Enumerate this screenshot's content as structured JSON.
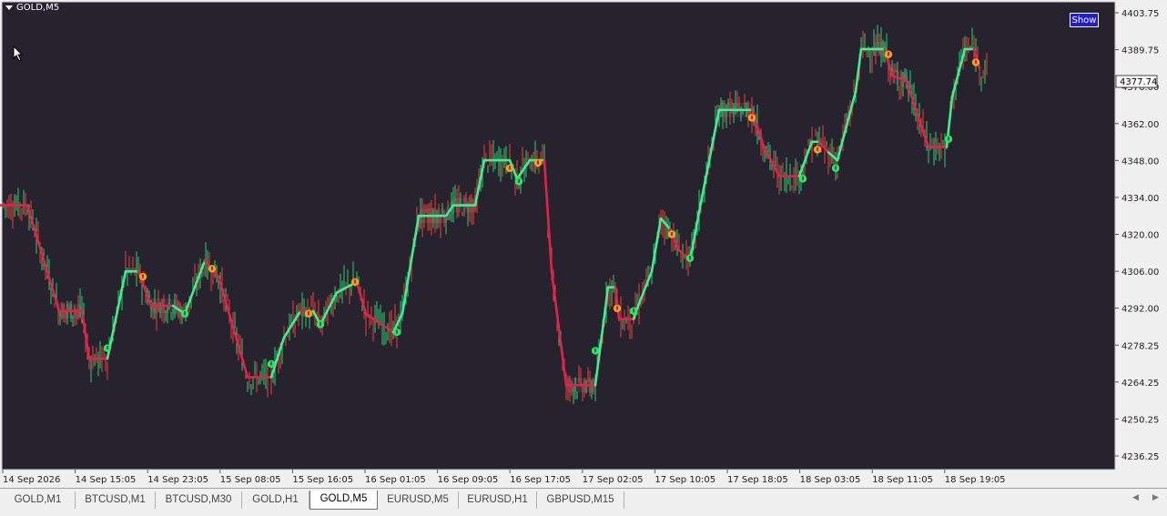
{
  "window": {
    "symbol_title": "GOLD,M5",
    "show_button": "Show",
    "current_price": "4377.74"
  },
  "colors": {
    "background": "#27232e",
    "grid_border": "#c8c8c8",
    "bull_candle": "#2ecc71",
    "bear_candle": "#e8413c",
    "trend_up": "#3df08f",
    "trend_down": "#e0234a",
    "signal_sell": "#f3a11d",
    "signal_buy": "#2ee36a",
    "axis_text": "#222222"
  },
  "price_axis": {
    "labels": [
      "4403.75",
      "4389.75",
      "4376.00",
      "4362.00",
      "4348.00",
      "4334.00",
      "4320.00",
      "4306.00",
      "4292.00",
      "4278.25",
      "4264.25",
      "4250.25",
      "4236.25"
    ]
  },
  "time_axis": {
    "labels": [
      "14 Sep 2026",
      "14 Sep 15:05",
      "14 Sep 23:05",
      "15 Sep 08:05",
      "15 Sep 16:05",
      "16 Sep 01:05",
      "16 Sep 09:05",
      "16 Sep 17:05",
      "17 Sep 02:05",
      "17 Sep 10:05",
      "17 Sep 18:05",
      "18 Sep 03:05",
      "18 Sep 11:05",
      "18 Sep 19:05"
    ]
  },
  "trend_line": {
    "points": [
      [
        0,
        4331,
        "d"
      ],
      [
        30,
        4331,
        "d"
      ],
      [
        65,
        4291,
        "d"
      ],
      [
        90,
        4291,
        "d"
      ],
      [
        98,
        4273,
        "d"
      ],
      [
        118,
        4273,
        "d"
      ],
      [
        138,
        4306,
        "u"
      ],
      [
        152,
        4306,
        "u"
      ],
      [
        166,
        4293,
        "d"
      ],
      [
        190,
        4293,
        "d"
      ],
      [
        203,
        4290,
        "u"
      ],
      [
        225,
        4310,
        "u"
      ],
      [
        240,
        4304,
        "d"
      ],
      [
        272,
        4266,
        "d"
      ],
      [
        298,
        4266,
        "d"
      ],
      [
        312,
        4281,
        "u"
      ],
      [
        330,
        4291,
        "u"
      ],
      [
        344,
        4291,
        "d"
      ],
      [
        352,
        4286,
        "u"
      ],
      [
        370,
        4298,
        "u"
      ],
      [
        392,
        4302,
        "u"
      ],
      [
        402,
        4290,
        "d"
      ],
      [
        432,
        4283,
        "d"
      ],
      [
        442,
        4290,
        "u"
      ],
      [
        460,
        4327,
        "u"
      ],
      [
        490,
        4327,
        "u"
      ],
      [
        498,
        4331,
        "u"
      ],
      [
        522,
        4331,
        "u"
      ],
      [
        532,
        4348,
        "u"
      ],
      [
        560,
        4348,
        "u"
      ],
      [
        568,
        4341,
        "u"
      ],
      [
        582,
        4348,
        "u"
      ],
      [
        598,
        4348,
        "u"
      ],
      [
        606,
        4306,
        "d"
      ],
      [
        622,
        4263,
        "d"
      ],
      [
        654,
        4263,
        "d"
      ],
      [
        668,
        4300,
        "u"
      ],
      [
        676,
        4300,
        "u"
      ],
      [
        680,
        4288,
        "d"
      ],
      [
        696,
        4288,
        "d"
      ],
      [
        700,
        4292,
        "u"
      ],
      [
        716,
        4306,
        "u"
      ],
      [
        726,
        4326,
        "u"
      ],
      [
        736,
        4322,
        "u"
      ],
      [
        746,
        4314,
        "d"
      ],
      [
        758,
        4310,
        "d"
      ],
      [
        770,
        4332,
        "u"
      ],
      [
        790,
        4367,
        "u"
      ],
      [
        826,
        4367,
        "u"
      ],
      [
        838,
        4354,
        "d"
      ],
      [
        856,
        4342,
        "d"
      ],
      [
        878,
        4342,
        "d"
      ],
      [
        892,
        4355,
        "u"
      ],
      [
        900,
        4355,
        "u"
      ],
      [
        910,
        4351,
        "d"
      ],
      [
        920,
        4348,
        "u"
      ],
      [
        940,
        4374,
        "u"
      ],
      [
        946,
        4390,
        "u"
      ],
      [
        972,
        4390,
        "u"
      ],
      [
        980,
        4380,
        "d"
      ],
      [
        996,
        4378,
        "d"
      ],
      [
        1010,
        4363,
        "d"
      ],
      [
        1020,
        4353,
        "d"
      ],
      [
        1040,
        4353,
        "d"
      ],
      [
        1046,
        4372,
        "u"
      ],
      [
        1060,
        4390,
        "u"
      ],
      [
        1070,
        4390,
        "u"
      ],
      [
        1076,
        4383,
        "d"
      ]
    ]
  },
  "signals": [
    [
      118,
      4277,
      "buy"
    ],
    [
      157,
      4304,
      "sell"
    ],
    [
      203,
      4290,
      "buy"
    ],
    [
      233,
      4307,
      "sell"
    ],
    [
      298,
      4271,
      "buy"
    ],
    [
      339,
      4290,
      "sell"
    ],
    [
      352,
      4286,
      "buy"
    ],
    [
      390,
      4302,
      "sell"
    ],
    [
      436,
      4283,
      "buy"
    ],
    [
      560,
      4345,
      "sell"
    ],
    [
      570,
      4340,
      "buy"
    ],
    [
      591,
      4347,
      "sell"
    ],
    [
      654,
      4276,
      "buy"
    ],
    [
      678,
      4292,
      "sell"
    ],
    [
      696,
      4291,
      "buy"
    ],
    [
      738,
      4320,
      "sell"
    ],
    [
      758,
      4311,
      "buy"
    ],
    [
      826,
      4364,
      "sell"
    ],
    [
      882,
      4341,
      "buy"
    ],
    [
      898,
      4352,
      "sell"
    ],
    [
      918,
      4345,
      "buy"
    ],
    [
      976,
      4388,
      "sell"
    ],
    [
      1042,
      4356,
      "buy"
    ],
    [
      1072,
      4385,
      "sell"
    ]
  ],
  "tabs": [
    {
      "label": "GOLD,M1",
      "active": false
    },
    {
      "label": "BTCUSD,M1",
      "active": false
    },
    {
      "label": "BTCUSD,M30",
      "active": false
    },
    {
      "label": "GOLD,H1",
      "active": false
    },
    {
      "label": "GOLD,M5",
      "active": true
    },
    {
      "label": "EURUSD,M5",
      "active": false
    },
    {
      "label": "EURUSD,H1",
      "active": false
    },
    {
      "label": "GBPUSD,M15",
      "active": false
    }
  ],
  "nav": {
    "left": "◀",
    "right": "▶"
  }
}
